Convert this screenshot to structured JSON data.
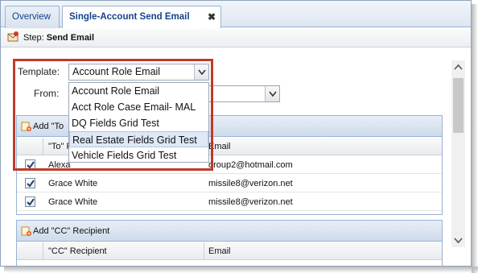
{
  "tabs": [
    {
      "label": "Overview"
    },
    {
      "label": "Single-Account Send Email"
    }
  ],
  "tab_close_glyph": "✖",
  "step": {
    "prefix": "Step:",
    "name": "Send Email"
  },
  "form": {
    "template_label": "Template:",
    "template_value": "Account Role Email",
    "from_label": "From:"
  },
  "dropdown_options": [
    "Account Role Email",
    "Acct Role Case Email- MAL",
    "DQ Fields Grid Test",
    "Real Estate Fields Grid Test",
    "Vehicle Fields Grid Test"
  ],
  "to_panel": {
    "title": "Add \"To\" Recipient",
    "visible_title": "Add \"To",
    "col_recipient": "\"To\" R",
    "col_email": "Email",
    "rows": [
      {
        "name": "Alexa",
        "email": "group2@hotmail.com",
        "checked": true
      },
      {
        "name": "Grace White",
        "email": "missile8@verizon.net",
        "checked": true
      },
      {
        "name": "Grace White",
        "email": "missile8@verizon.net",
        "checked": true
      }
    ]
  },
  "cc_panel": {
    "title": "Add \"CC\" Recipient",
    "col_recipient": "\"CC\" Recipient",
    "col_email": "Email"
  },
  "colors": {
    "highlight": "#c0392b",
    "tab_text": "#15428b",
    "hover": "#dfe8f6"
  },
  "icons": [
    "email-step-icon",
    "add-recipient-icon",
    "close-icon",
    "dropdown-arrow-icon",
    "scroll-up-icon",
    "scroll-down-icon",
    "checkbox-checked-icon"
  ]
}
